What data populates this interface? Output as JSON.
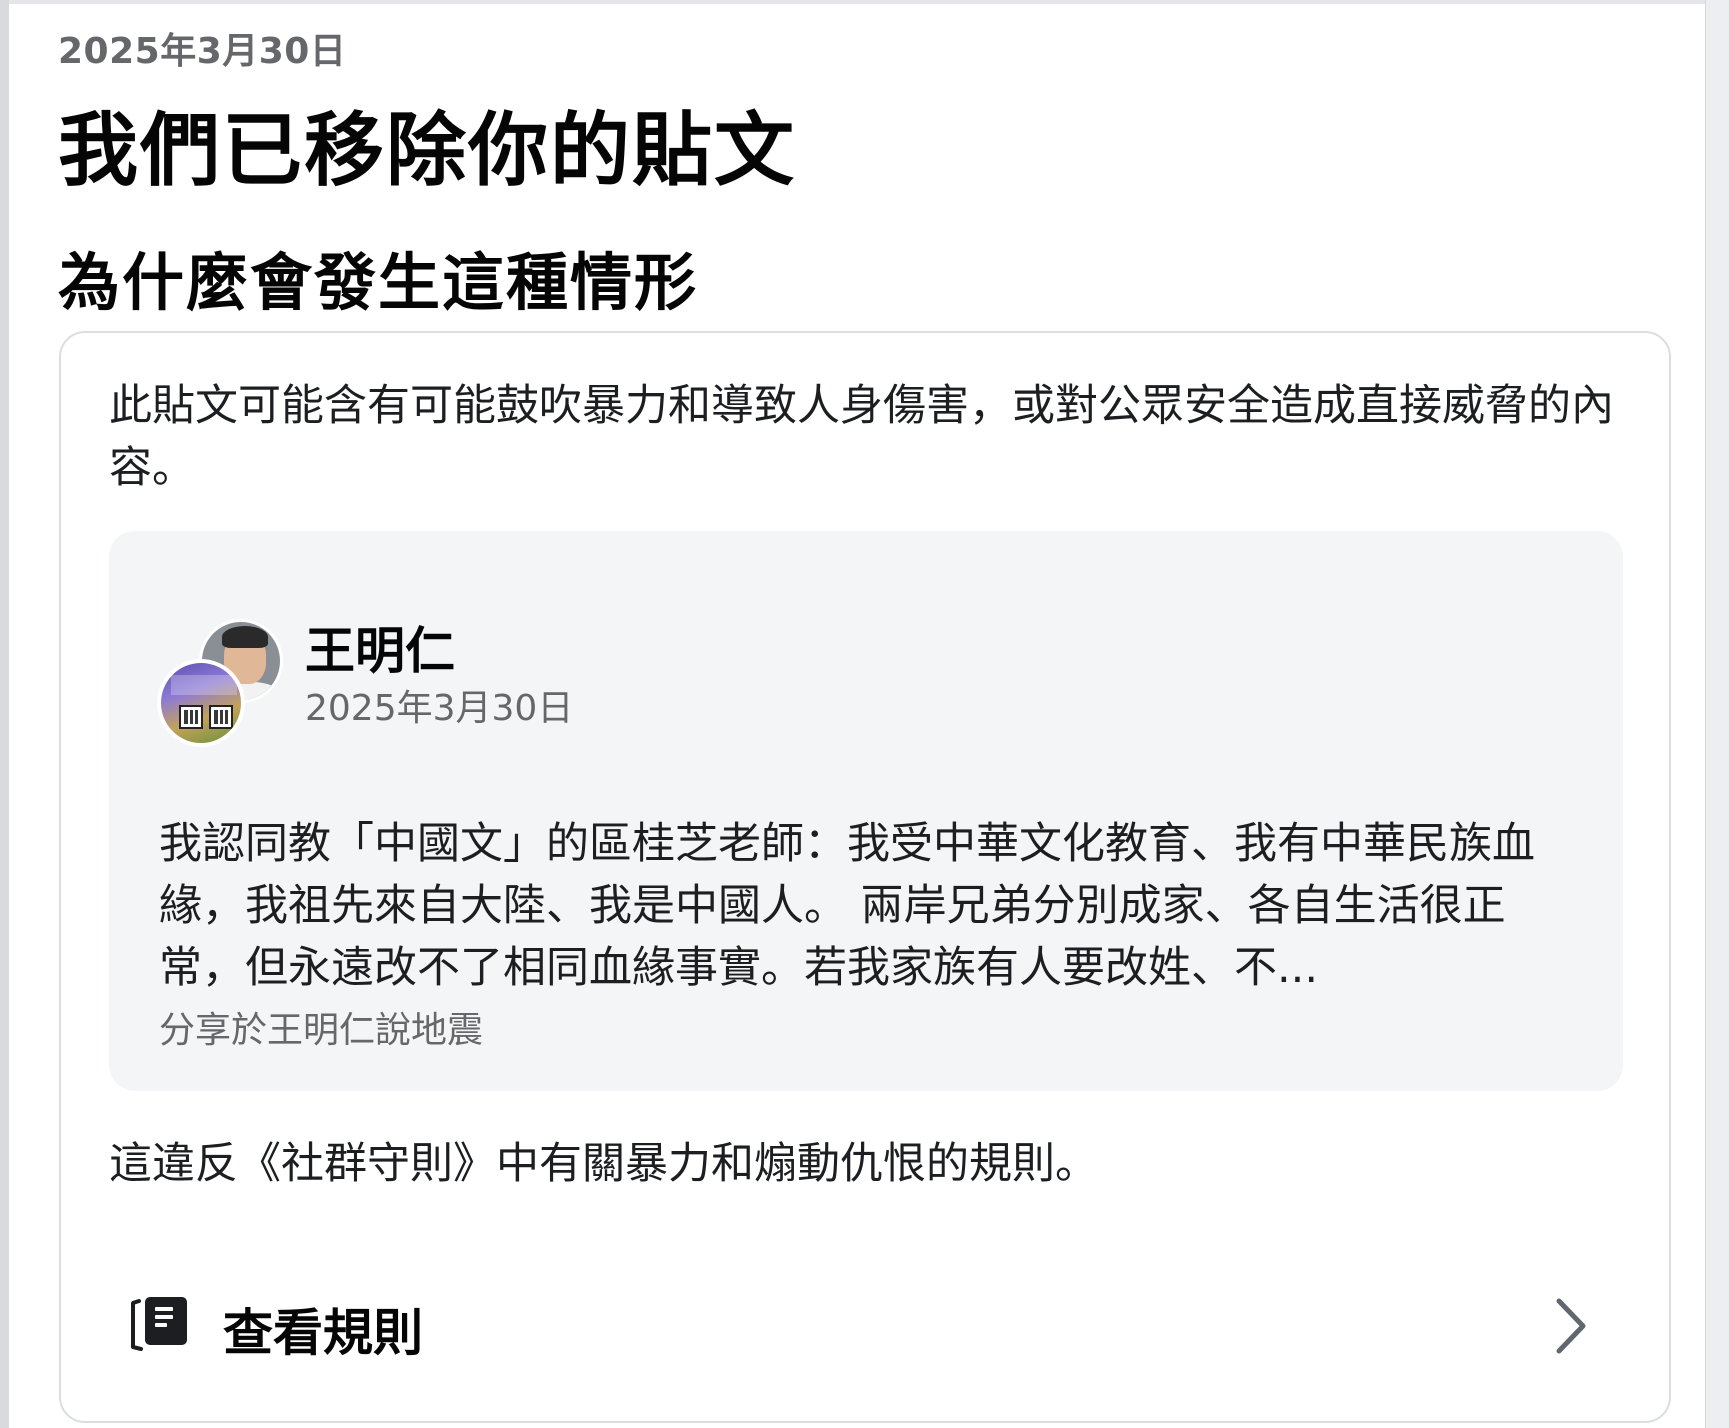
{
  "header": {
    "date": "2025年3月30日",
    "title": "我們已移除你的貼文",
    "subtitle": "為什麼會發生這種情形"
  },
  "card": {
    "reason": "此貼文可能含有可能鼓吹暴力和導致人身傷害，或對公眾安全造成直接威脅的內容。",
    "post": {
      "author": "王明仁",
      "date": "2025年3月30日",
      "text": "我認同教「中國文」的區桂芝老師：我受中華文化教育、我有中華民族血緣，我祖先來自大陸、我是中國人。 兩岸兄弟分別成家、各自生活很正常，但永遠改不了相同血緣事實。若我家族有人要改姓、不...",
      "shared_in": "分享於王明仁說地震"
    },
    "violation": "這違反《社群守則》中有關暴力和煽動仇恨的規則。",
    "rules_link": {
      "label": "查看規則",
      "icon": "book-icon"
    }
  }
}
